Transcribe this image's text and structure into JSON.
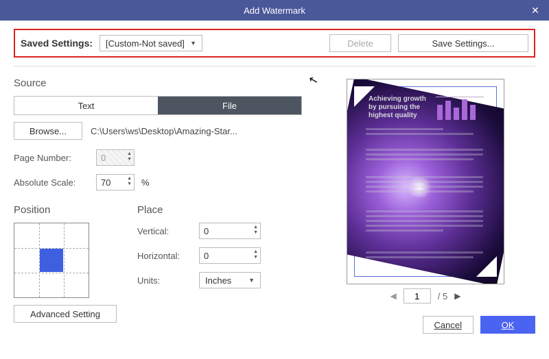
{
  "title": "Add Watermark",
  "saved": {
    "label": "Saved Settings:",
    "dropdown": "[Custom-Not saved]",
    "delete": "Delete",
    "save": "Save Settings..."
  },
  "source": {
    "heading": "Source",
    "tabs": {
      "text": "Text",
      "file": "File"
    },
    "browse": "Browse...",
    "path": "C:\\Users\\ws\\Desktop\\Amazing-Star...",
    "page_number_label": "Page Number:",
    "page_number_value": "0",
    "abs_scale_label": "Absolute Scale:",
    "abs_scale_value": "70",
    "abs_scale_unit": "%"
  },
  "position": {
    "heading": "Position"
  },
  "place": {
    "heading": "Place",
    "vertical_label": "Vertical:",
    "vertical_value": "0",
    "horizontal_label": "Horizontal:",
    "horizontal_value": "0",
    "units_label": "Units:",
    "units_value": "Inches"
  },
  "preview": {
    "doc_title_l1": "Achieving growth",
    "doc_title_l2": "by pursuing the",
    "doc_title_l3": "highest quality"
  },
  "pager": {
    "current": "1",
    "total": "/ 5"
  },
  "footer": {
    "advanced": "Advanced Setting",
    "cancel": "Cancel",
    "ok": "OK"
  }
}
